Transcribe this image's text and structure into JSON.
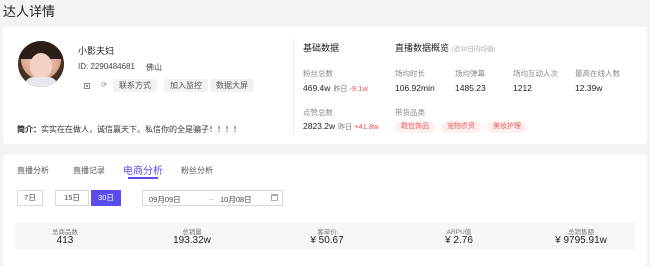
{
  "page_title": "达人详情",
  "profile": {
    "name": "小影夫妇",
    "id_label": "ID: 2290484681",
    "city": "佛山",
    "actions": [
      "联系方式",
      "加入监控",
      "数据大屏"
    ],
    "bio_label": "简介：",
    "bio_text": "实实在在做人，诚信赢天下。私信你的全是骗子！！！！"
  },
  "basic_data": {
    "title": "基础数据",
    "fans_label": "粉丝总数",
    "fans_value": "469.4w",
    "fans_delta_label": "昨日",
    "fans_delta": "-9.1w",
    "likes_label": "点赞总数",
    "likes_value": "2823.2w",
    "likes_delta_label": "昨日",
    "likes_delta": "+41.8w"
  },
  "live_overview": {
    "title": "直播数据概览",
    "subtitle": "(近30日内均值)",
    "metrics": [
      {
        "label": "场均时长",
        "value": "106.92min"
      },
      {
        "label": "场均弹幕",
        "value": "1485.23"
      },
      {
        "label": "场均互动人次",
        "value": "1212"
      },
      {
        "label": "最高在线人数",
        "value": "12.39w"
      }
    ],
    "category_label": "带货品类",
    "tags": [
      "鞋包饰品",
      "宠物农资",
      "美妆护理"
    ]
  },
  "tabs": [
    "直播分析",
    "直播记录",
    "电商分析",
    "粉丝分析"
  ],
  "active_tab": "电商分析",
  "range_buttons": [
    "7日",
    "15日",
    "30日"
  ],
  "active_range": "30日",
  "date_range": {
    "start": "09月09日",
    "arrow": "→",
    "end": "10月08日"
  },
  "stats": [
    {
      "label": "总商品数",
      "value": "413"
    },
    {
      "label": "总销量",
      "value": "193.32w"
    },
    {
      "label": "客单价",
      "value": "¥ 50.67"
    },
    {
      "label": "ARPU值",
      "value": "¥ 2.76"
    },
    {
      "label": "总销售额",
      "value": "¥ 9795.91w"
    }
  ],
  "colors": {
    "accent": "#5b4cf0",
    "negative": "#f04d4d",
    "tag_bg": "#fff0f0"
  }
}
